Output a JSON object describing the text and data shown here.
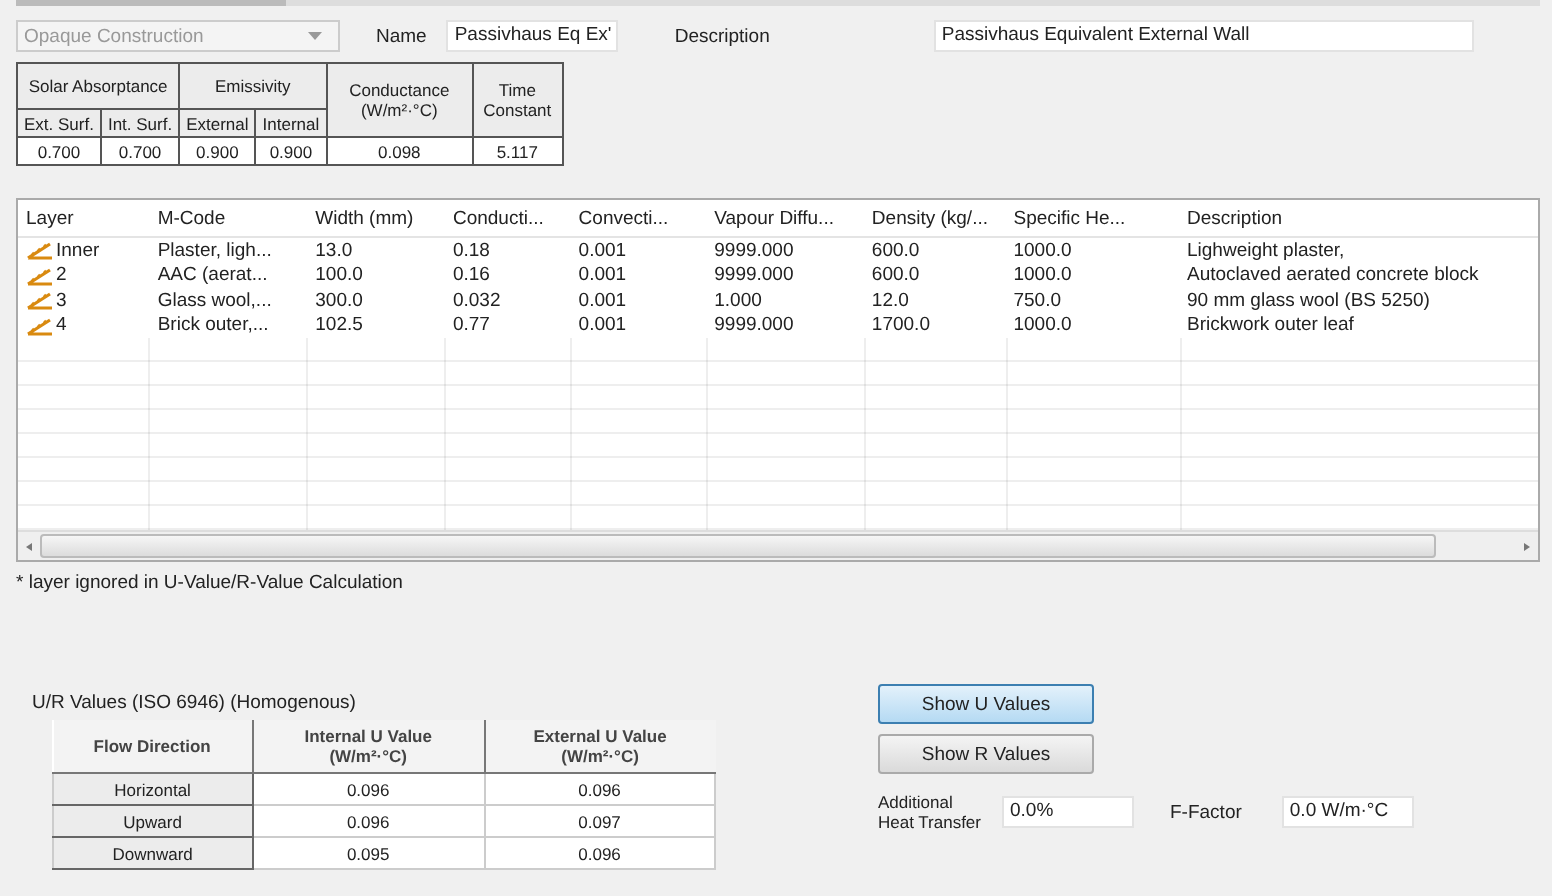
{
  "construction_type": {
    "value": "Opaque Construction"
  },
  "name": {
    "label": "Name",
    "value": "Passivhaus Eq Ex'"
  },
  "description": {
    "label": "Description",
    "value": "Passivhaus Equivalent External Wall"
  },
  "properties": {
    "groups": [
      "Solar Absorptance",
      "Emissivity"
    ],
    "subheaders": [
      "Ext. Surf.",
      "Int. Surf.",
      "External",
      "Internal"
    ],
    "conductance": "Conductance (W/m²·°C)",
    "time_constant": "Time Constant",
    "values": [
      "0.700",
      "0.700",
      "0.900",
      "0.900",
      "0.098",
      "5.117"
    ]
  },
  "layers": {
    "columns": [
      "Layer",
      "M-Code",
      "Width (mm)",
      "Conducti...",
      "Convecti...",
      "Vapour Diffu...",
      "Density (kg/...",
      "Specific He...",
      "Description"
    ],
    "rows": [
      [
        "Inner",
        "Plaster, ligh...",
        "13.0",
        "0.18",
        "0.001",
        "9999.000",
        "600.0",
        "1000.0",
        "Lighweight plaster,"
      ],
      [
        "2",
        "AAC (aerat...",
        "100.0",
        "0.16",
        "0.001",
        "9999.000",
        "600.0",
        "1000.0",
        "Autoclaved aerated concrete block"
      ],
      [
        "3",
        "Glass wool,...",
        "300.0",
        "0.032",
        "0.001",
        "1.000",
        "12.0",
        "750.0",
        "90 mm glass wool (BS 5250)"
      ],
      [
        "4",
        "Brick outer,...",
        "102.5",
        "0.77",
        "0.001",
        "9999.000",
        "1700.0",
        "1000.0",
        "Brickwork outer leaf"
      ]
    ]
  },
  "note": "* layer ignored in U-Value/R-Value Calculation",
  "results": {
    "title": "U/R Values (ISO 6946) (Homogenous)",
    "columns": [
      "Flow Direction",
      "Internal U Value (W/m²·°C)",
      "External U Value (W/m²·°C)"
    ],
    "rows": [
      [
        "Horizontal",
        "0.096",
        "0.096"
      ],
      [
        "Upward",
        "0.096",
        "0.097"
      ],
      [
        "Downward",
        "0.095",
        "0.096"
      ]
    ]
  },
  "buttons": [
    {
      "label": "Show U Values",
      "selected": true
    },
    {
      "label": "Show R Values",
      "selected": false
    }
  ],
  "additional_heat_transfer": {
    "label": "Additional Heat Transfer",
    "value": "0.0%"
  },
  "f_factor": {
    "label": "F-Factor",
    "value": "0.0 W/m·°C"
  }
}
